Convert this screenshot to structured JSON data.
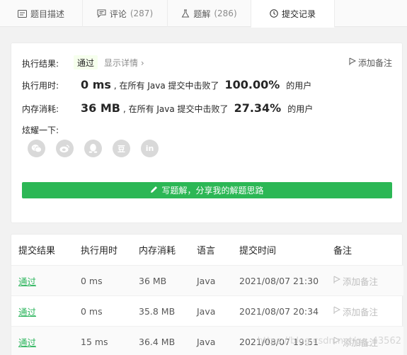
{
  "tabs": [
    {
      "label": "题目描述",
      "count": ""
    },
    {
      "label": "评论",
      "count": "(287)"
    },
    {
      "label": "题解",
      "count": "(286)"
    },
    {
      "label": "提交记录",
      "count": ""
    }
  ],
  "result": {
    "status_label": "执行结果:",
    "status_value": "通过",
    "details_link": "显示详情 ›",
    "add_note": "添加备注",
    "time_label": "执行用时:",
    "time_value": "0 ms",
    "time_mid": ", 在所有 Java 提交中击败了",
    "time_pct": "100.00%",
    "time_suffix": "的用户",
    "mem_label": "内存消耗:",
    "mem_value": "36 MB",
    "mem_mid": ", 在所有 Java 提交中击败了",
    "mem_pct": "27.34%",
    "mem_suffix": "的用户",
    "share_label": "炫耀一下:",
    "share_icons": [
      "wechat-icon",
      "weibo-icon",
      "qq-icon",
      "douban-icon",
      "linkedin-icon"
    ],
    "douban_glyph": "豆",
    "linkedin_glyph": "in",
    "write_button": "写题解，分享我的解题思路"
  },
  "table": {
    "headers": [
      "提交结果",
      "执行用时",
      "内存消耗",
      "语言",
      "提交时间",
      "备注"
    ],
    "rows": [
      {
        "status": "通过",
        "time": "0 ms",
        "memory": "36 MB",
        "lang": "Java",
        "submitted": "2021/08/07 21:30",
        "note": "添加备注"
      },
      {
        "status": "通过",
        "time": "0 ms",
        "memory": "35.8 MB",
        "lang": "Java",
        "submitted": "2021/08/07 20:34",
        "note": "添加备注"
      },
      {
        "status": "通过",
        "time": "15 ms",
        "memory": "36.4 MB",
        "lang": "Java",
        "submitted": "2021/08/07 19:51",
        "note": "添加备注"
      }
    ]
  },
  "watermark": "https://blog.csdn.net/qq_43562",
  "colors": {
    "accent_green": "#2cb755",
    "pass_text": "#2db55d"
  }
}
